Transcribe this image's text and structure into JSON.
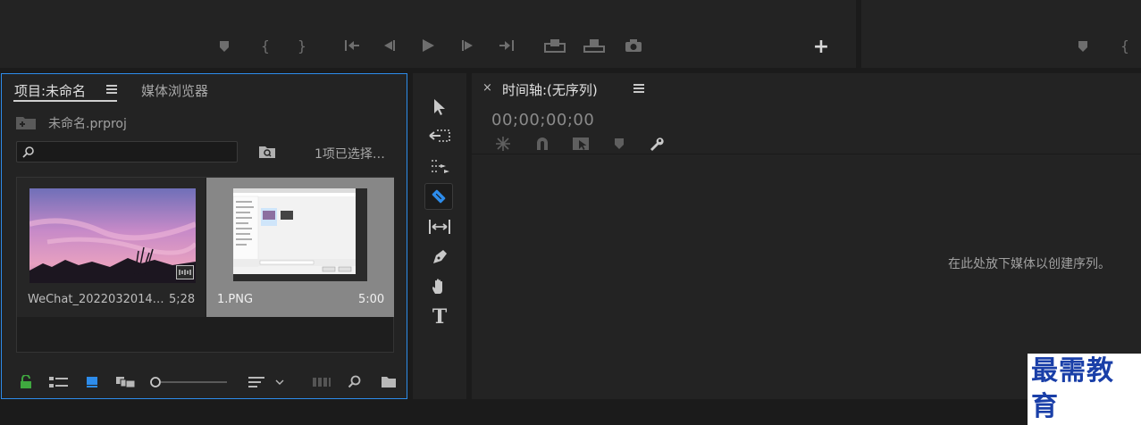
{
  "colors": {
    "panel_bg": "#232323",
    "app_bg": "#1b1b1b",
    "active_border": "#2d8ceb",
    "accent_blue": "#2d8ceb",
    "lock_green": "#3fa83f",
    "selected_clip_bg": "#878787",
    "watermark_blue": "#1a3fa8"
  },
  "source_monitor": {
    "transport_icons": [
      "marker-icon",
      "in-point-icon",
      "out-point-icon",
      "go-to-in-icon",
      "step-back-icon",
      "play-icon",
      "step-forward-icon",
      "go-to-out-icon",
      "insert-icon",
      "overwrite-icon",
      "export-frame-icon",
      "add-button-icon"
    ]
  },
  "program_monitor": {
    "transport_icons": [
      "marker-icon",
      "in-point-icon"
    ]
  },
  "project_panel": {
    "tab_project": "项目:未命名",
    "tab_media_browser": "媒体浏览器",
    "project_file": "未命名.prproj",
    "selection_count": "1项已选择…",
    "clips": [
      {
        "name": "WeChat_2022032014…",
        "duration": "5;28",
        "selected": false
      },
      {
        "name": "1.PNG",
        "duration": "5:00",
        "selected": true
      }
    ],
    "bottom_icons": [
      "lock-icon",
      "list-view-icon",
      "icon-view-icon",
      "freeform-view-icon",
      "zoom-slider",
      "sort-icon",
      "automate-to-sequence-icon",
      "find-icon",
      "new-bin-icon"
    ]
  },
  "tools": [
    "selection-tool-icon",
    "track-select-forward-icon",
    "ripple-edit-icon",
    "razor-tool-icon",
    "slip-tool-icon",
    "pen-tool-icon",
    "hand-tool-icon",
    "type-tool-icon"
  ],
  "timeline_panel": {
    "tab_title": "时间轴:(无序列)",
    "close_glyph": "×",
    "timecode": "00;00;00;00",
    "drop_hint": "在此处放下媒体以创建序列。",
    "toolbar_icons": [
      "nest-icon",
      "snap-icon",
      "linked-selection-icon",
      "add-marker-icon",
      "settings-wrench-icon"
    ]
  },
  "watermark": "最需教育"
}
